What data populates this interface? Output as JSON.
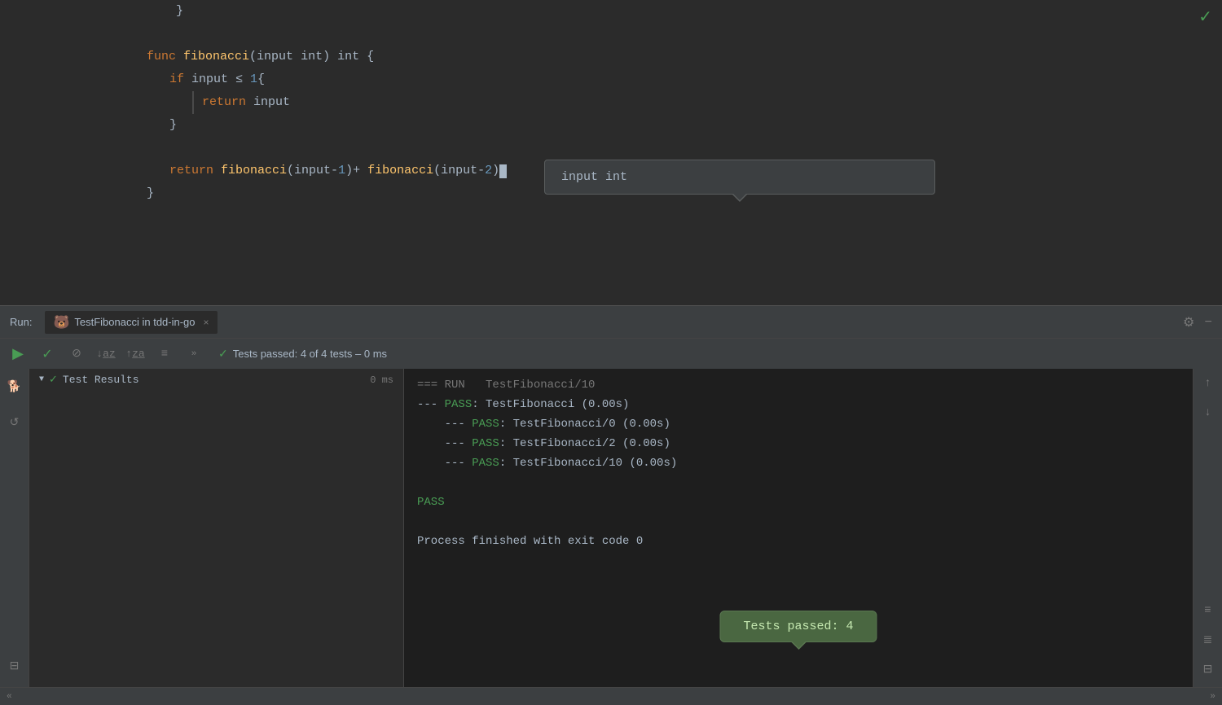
{
  "editor": {
    "lines": [
      {
        "indent": 2,
        "content": "}"
      },
      {
        "indent": 0,
        "content": ""
      },
      {
        "indent": 0,
        "content": "func fibonacci(input int) int {",
        "type": "func-sig"
      },
      {
        "indent": 1,
        "content": "if input ≤ 1{",
        "type": "if"
      },
      {
        "indent": 2,
        "content": "return input",
        "type": "return"
      },
      {
        "indent": 1,
        "content": "}"
      },
      {
        "indent": 0,
        "content": ""
      },
      {
        "indent": 1,
        "content": "return fibonacci(input-1)+ fibonacci(input-2)",
        "type": "return"
      },
      {
        "indent": 0,
        "content": "}"
      }
    ],
    "checkmark": "✓"
  },
  "tooltip": {
    "keyword": "input",
    "space": " ",
    "type": "int"
  },
  "run_panel": {
    "run_label": "Run:",
    "tab_icon": "🐻",
    "tab_text": "TestFibonacci in tdd-in-go",
    "tab_close": "×"
  },
  "toolbar": {
    "play_icon": "▶",
    "check_icon": "✓",
    "stop_icon": "⊘",
    "sort_az": "↓a̲z̲",
    "sort_za": "↑z̲a̲",
    "align_icon": "≡",
    "more_icon": "»",
    "status_check": "✓",
    "status_text": "Tests passed: 4 of 4 tests – 0 ms"
  },
  "test_results": {
    "label": "Test Results",
    "ms": "0 ms"
  },
  "output": {
    "lines": [
      "=== RUN   TestFibonacci/10",
      "--- PASS: TestFibonacci (0.00s)",
      "    --- PASS: TestFibonacci/0 (0.00s)",
      "    --- PASS: TestFibonacci/2 (0.00s)",
      "    --- PASS: TestFibonacci/10 (0.00s)",
      "",
      "PASS",
      "",
      "Process finished with exit code 0"
    ]
  },
  "toast": {
    "text": "Tests passed: 4"
  },
  "icons": {
    "gear": "⚙",
    "minus": "−",
    "arrow_up": "↑",
    "arrow_down": "↓",
    "list_icon": "≡",
    "list2_icon": "≣",
    "print_icon": "⊟",
    "chevron_down": "»",
    "chevron_left": "«",
    "dog_icon": "🐕",
    "refresh_icon": "↺"
  }
}
